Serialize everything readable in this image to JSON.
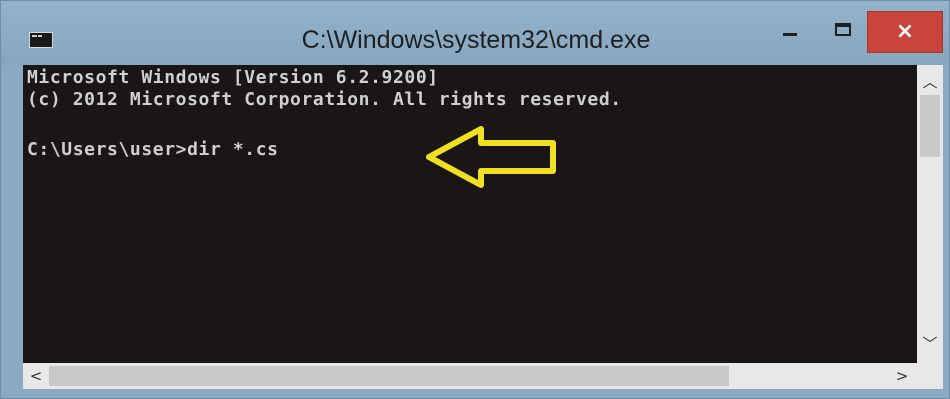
{
  "window": {
    "title": "C:\\Windows\\system32\\cmd.exe",
    "close_glyph": "×",
    "icons": {
      "system": "console-icon",
      "minimize": "minimize-icon",
      "maximize": "maximize-icon",
      "close": "close-icon"
    }
  },
  "console": {
    "lines": [
      "Microsoft Windows [Version 6.2.9200]",
      "(c) 2012 Microsoft Corporation. All rights reserved.",
      "",
      "C:\\Users\\user>dir *.cs"
    ],
    "text_color": "#cfcfcf",
    "background": "#1a1616"
  },
  "annotation": {
    "icon": "left-arrow-icon",
    "color": "#f0e020"
  },
  "scrollbars": {
    "up_glyph": "︿",
    "down_glyph": "﹀",
    "left_glyph": "<",
    "right_glyph": ">"
  }
}
